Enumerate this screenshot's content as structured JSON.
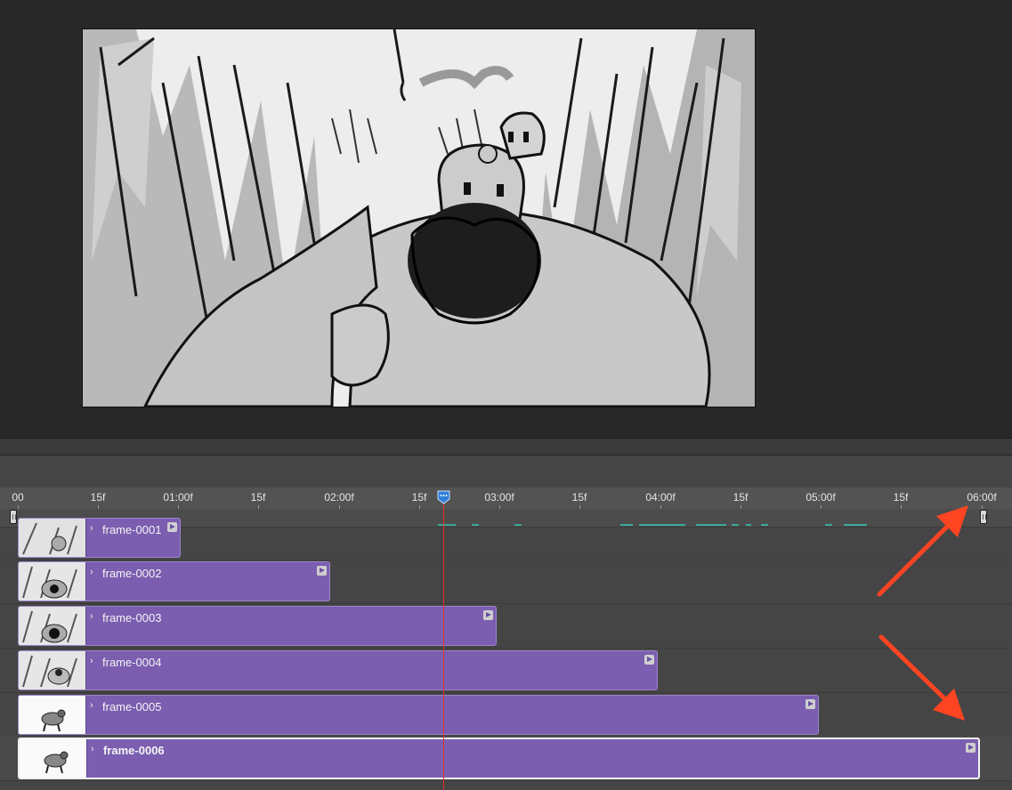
{
  "timeline": {
    "ruler_ticks": [
      "00",
      "15f",
      "01:00f",
      "15f",
      "02:00f",
      "15f",
      "03:00f",
      "15f",
      "04:00f",
      "15f",
      "05:00f",
      "15f",
      "06:00f"
    ],
    "tracks": [
      {
        "label": "frame-0001",
        "selected": false
      },
      {
        "label": "frame-0002",
        "selected": false
      },
      {
        "label": "frame-0003",
        "selected": false
      },
      {
        "label": "frame-0004",
        "selected": false
      },
      {
        "label": "frame-0005",
        "selected": false
      },
      {
        "label": "frame-0006",
        "selected": true
      }
    ],
    "chevron": "›",
    "clip_color": "#7b5eb0",
    "playhead_color": "#e0302a",
    "cache_color": "#3aa89a"
  },
  "annotations": {
    "arrow_color": "#ff4422"
  },
  "icons": {
    "playhead": "playhead-marker-icon",
    "work_start": "work-area-start-handle-icon",
    "work_end": "work-area-end-handle-icon",
    "clip_end": "clip-play-icon"
  }
}
